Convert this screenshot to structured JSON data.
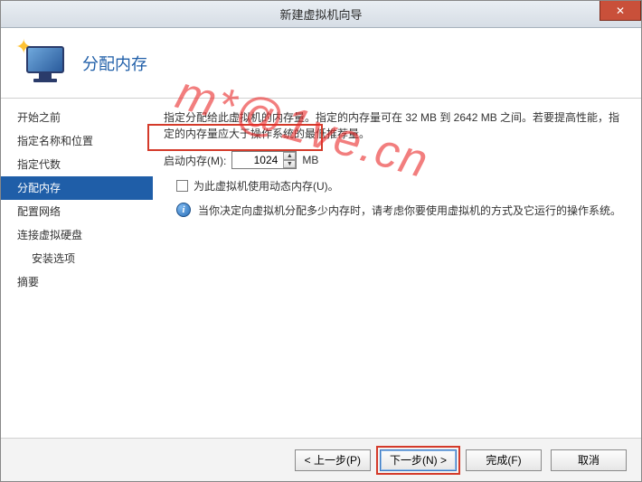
{
  "window": {
    "title": "新建虚拟机向导",
    "close_symbol": "✕"
  },
  "header": {
    "title": "分配内存"
  },
  "sidebar": {
    "items": [
      {
        "label": "开始之前",
        "indent": false,
        "active": false
      },
      {
        "label": "指定名称和位置",
        "indent": false,
        "active": false
      },
      {
        "label": "指定代数",
        "indent": false,
        "active": false
      },
      {
        "label": "分配内存",
        "indent": false,
        "active": true
      },
      {
        "label": "配置网络",
        "indent": false,
        "active": false
      },
      {
        "label": "连接虚拟硬盘",
        "indent": false,
        "active": false
      },
      {
        "label": "安装选项",
        "indent": true,
        "active": false
      },
      {
        "label": "摘要",
        "indent": false,
        "active": false
      }
    ]
  },
  "content": {
    "description": "指定分配给此虚拟机的内存量。指定的内存量可在 32 MB 到 2642 MB 之间。若要提高性能，指定的内存量应大于操作系统的最低推荐量。",
    "memory_label": "启动内存(M):",
    "memory_value": "1024",
    "memory_unit": "MB",
    "dyn_mem_label": "为此虚拟机使用动态内存(U)。",
    "info_text": "当你决定向虚拟机分配多少内存时，请考虑你要使用虚拟机的方式及它运行的操作系统。"
  },
  "footer": {
    "prev": "< 上一步(P)",
    "next": "下一步(N) >",
    "finish": "完成(F)",
    "cancel": "取消"
  },
  "watermark": "m*@1ve.cn"
}
